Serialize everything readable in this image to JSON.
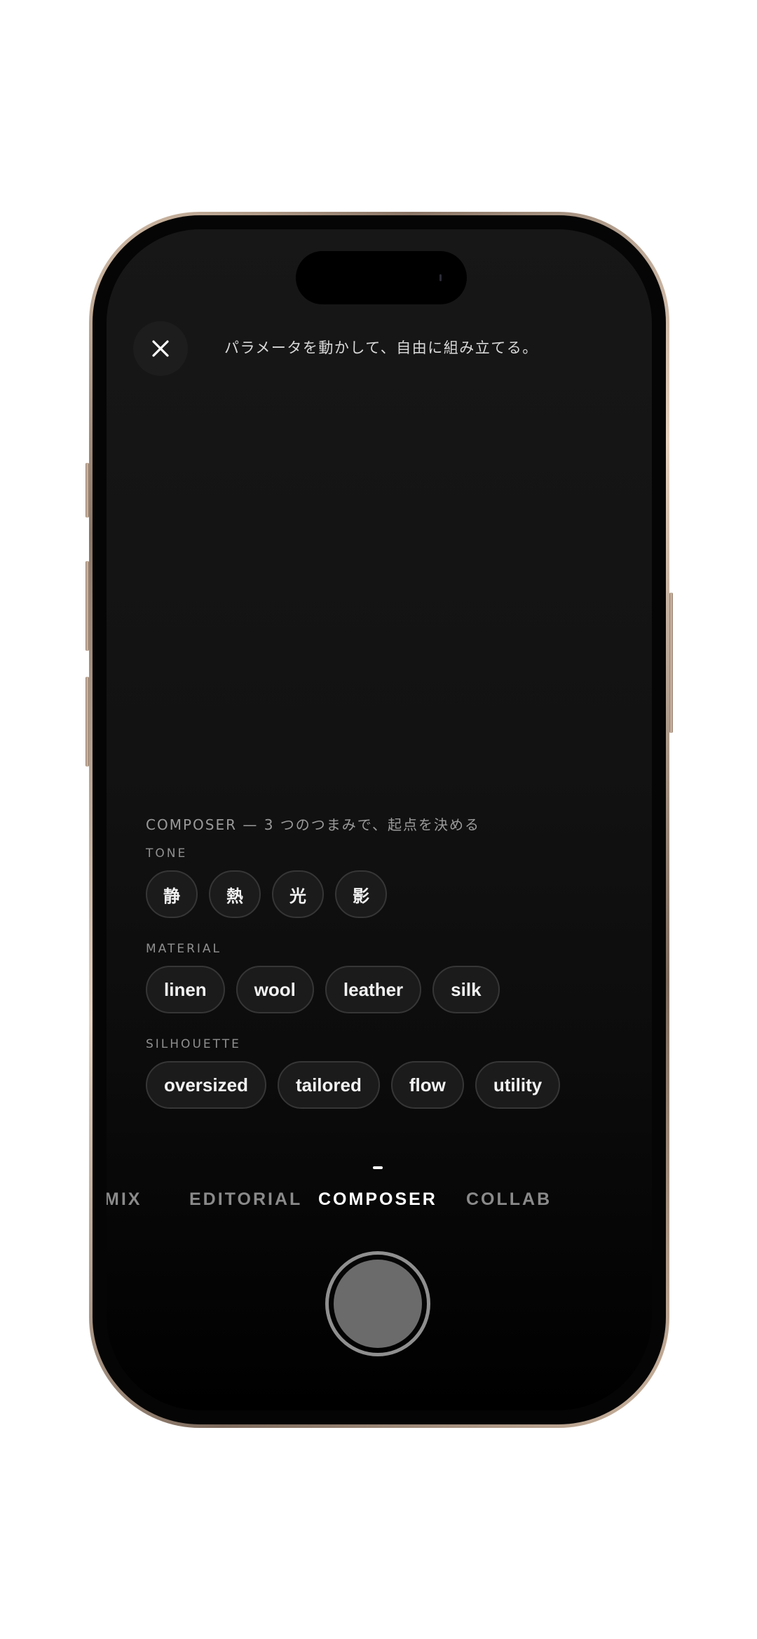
{
  "header": {
    "close_icon": "close-icon",
    "hint": "パラメータを動かして、自由に組み立てる。"
  },
  "composer": {
    "title": "COMPOSER — 3 つのつまみで、起点を決める",
    "tone": {
      "label": "TONE",
      "options": [
        "静",
        "熱",
        "光",
        "影"
      ]
    },
    "material": {
      "label": "MATERIAL",
      "options": [
        "linen",
        "wool",
        "leather",
        "silk"
      ]
    },
    "silhouette": {
      "label": "SILHOUETTE",
      "options": [
        "oversized",
        "tailored",
        "flow",
        "utility"
      ]
    }
  },
  "modes": {
    "items": [
      "MIX",
      "EDITORIAL",
      "COMPOSER",
      "COLLAB"
    ],
    "active": "COMPOSER"
  },
  "colors": {
    "screen_background": "#121212",
    "chip_background": "#1b1b1b",
    "chip_border": "#363636",
    "active_mode": "#ffffff",
    "inactive_mode": "#8a8a8a",
    "shutter": "#6b6b6b"
  }
}
